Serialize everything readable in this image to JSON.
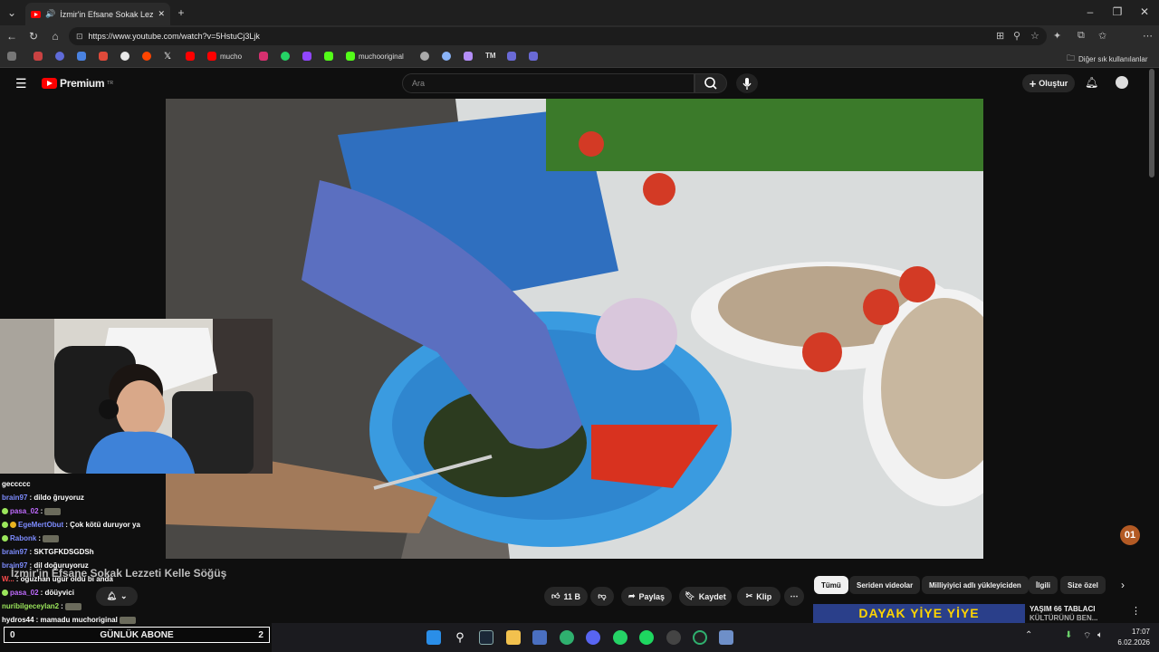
{
  "browser": {
    "tab_title": "İzmir'in Efsane Sokak Lezzeti",
    "url": "https://www.youtube.com/watch?v=5HstuCj3Ljk",
    "bookmarks": [
      "mucho",
      "muchooriginal",
      "TM"
    ],
    "bookmarks_folder": "Diğer sık kullanılanlar"
  },
  "youtube": {
    "logo_text": "Premium",
    "logo_sup": "TR",
    "search_placeholder": "Ara",
    "create_label": "Oluştur",
    "video_title": "İzmir'in Efsane Sokak Lezzeti Kelle Söğüş",
    "like_count": "11 B",
    "share_label": "Paylaş",
    "save_label": "Kaydet",
    "clip_label": "Klip",
    "chips": [
      "Tümü",
      "Seriden videolar",
      "Milliyiyici adlı yükleyiciden",
      "İlgili",
      "Size özel"
    ],
    "rec_title_1": "YAŞIM 66 TABLACI",
    "rec_title_2": "KÜLTÜRÜNÜ BEN...",
    "rec_thumb_text": "DAYAK YİYE YİYE",
    "watermark": "01"
  },
  "chat": [
    {
      "user": "",
      "msg": "geccccc"
    },
    {
      "user": "brain97",
      "msg": ": dildo ğruyoruz"
    },
    {
      "user": "pasa_02",
      "msg": ":"
    },
    {
      "user": "EgeMertObut",
      "msg": ": Çok kötü duruyor ya"
    },
    {
      "user": "Rabonk",
      "msg": ":"
    },
    {
      "user": "brain97",
      "msg": ": SKTGFKDSGDSh"
    },
    {
      "user": "brain97",
      "msg": ": dil doğuruyoruz"
    },
    {
      "user": "W...",
      "msg": ": oğuzhan uğur oldu bi anda"
    },
    {
      "user": "pasa_02",
      "msg": ": döüyvici"
    },
    {
      "user": "nuribilgeceylan2",
      "msg": ":"
    },
    {
      "user": "hydros44",
      "msg": ": mamadu muchoriginal"
    }
  ],
  "sub_goal": {
    "left": "0",
    "label": "GÜNLÜK ABONE",
    "right": "2"
  },
  "clock": {
    "time": "17:07",
    "date": "6.02.2026"
  },
  "colors": {
    "yt_red": "#ff0000",
    "chat_user": "#7d8cff"
  }
}
